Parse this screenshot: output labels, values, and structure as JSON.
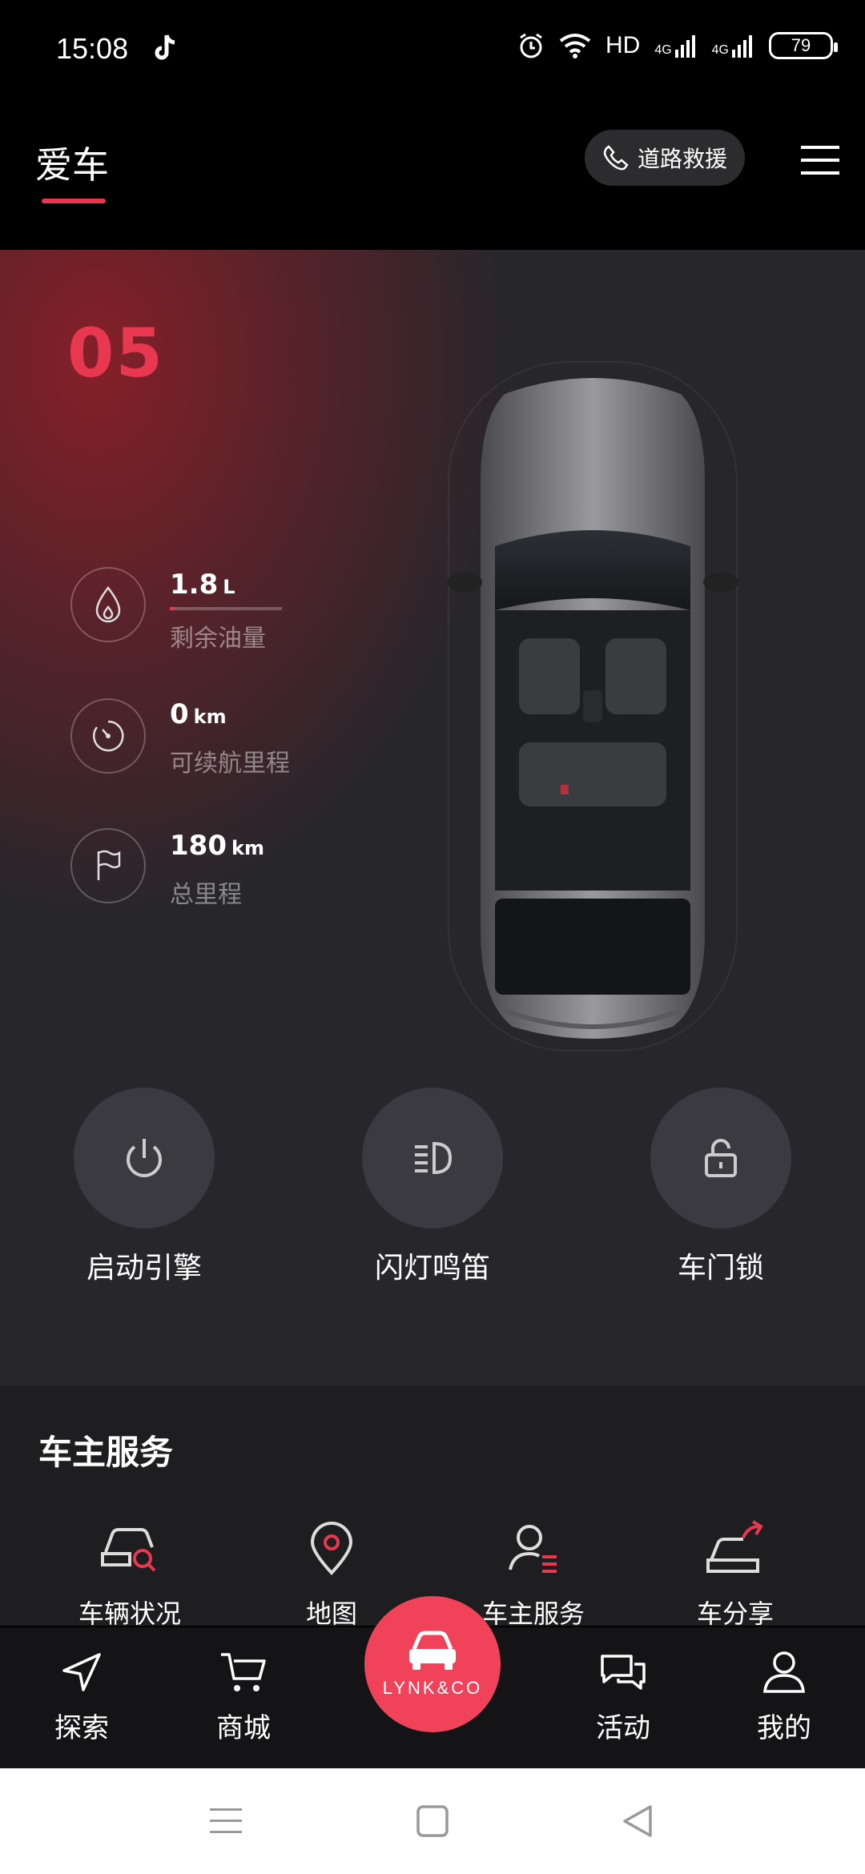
{
  "status_bar": {
    "time": "15:08",
    "network_label": "HD",
    "signal1": "4G",
    "signal2": "4G",
    "battery": "79"
  },
  "header": {
    "title": "爱车",
    "rescue_label": "道路救援"
  },
  "vehicle": {
    "model": "05",
    "stats": [
      {
        "value": "1.8",
        "unit": "L",
        "label": "剩余油量",
        "icon": "fuel-drop-icon"
      },
      {
        "value": "0",
        "unit": "km",
        "label": "可续航里程",
        "icon": "speedometer-icon"
      },
      {
        "value": "180",
        "unit": "km",
        "label": "总里程",
        "icon": "flag-icon"
      }
    ],
    "fuel_level_fraction": 0.04,
    "controls": [
      {
        "label": "启动引擎",
        "icon": "power-icon"
      },
      {
        "label": "闪灯鸣笛",
        "icon": "headlight-icon"
      },
      {
        "label": "车门锁",
        "icon": "unlock-icon"
      }
    ]
  },
  "services": {
    "title": "车主服务",
    "items": [
      {
        "label": "车辆状况",
        "icon": "car-search-icon"
      },
      {
        "label": "地图",
        "icon": "map-pin-icon"
      },
      {
        "label": "车主服务",
        "icon": "owner-service-icon"
      },
      {
        "label": "车分享",
        "icon": "car-share-icon"
      }
    ]
  },
  "tabbar": {
    "items": [
      {
        "label": "探索",
        "icon": "navigate-icon"
      },
      {
        "label": "商城",
        "icon": "cart-icon"
      },
      {
        "label": "活动",
        "icon": "chat-icon"
      },
      {
        "label": "我的",
        "icon": "person-icon"
      }
    ],
    "center_brand": "LYNK&CO"
  },
  "colors": {
    "accent": "#e8384f",
    "card_bg": "#26262b",
    "page_bg": "#000000"
  }
}
